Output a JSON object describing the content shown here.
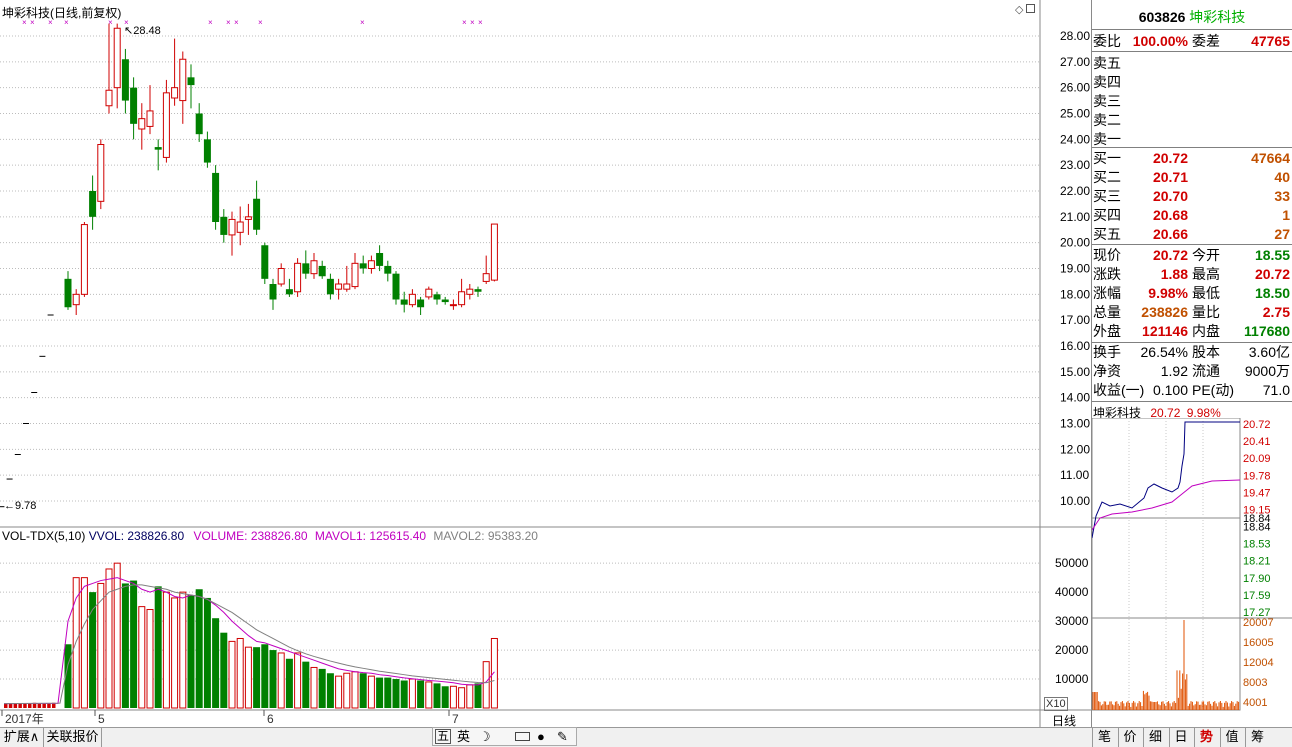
{
  "chart": {
    "title": "坤彩科技(日线,前复权)",
    "high_mark": "28.48",
    "low_mark": "9.78",
    "price_ticks": [
      "28.00",
      "27.00",
      "26.00",
      "25.00",
      "24.00",
      "23.00",
      "22.00",
      "21.00",
      "20.00",
      "19.00",
      "18.00",
      "17.00",
      "16.00",
      "15.00",
      "14.00",
      "13.00",
      "12.00",
      "11.00",
      "10.00"
    ],
    "volume_header": {
      "label": "VOL-TDX(5,10)",
      "vvol": "VVOL: 238826.80",
      "volume": "VOLUME: 238826.80",
      "mavol1": "MAVOL1: 125615.40",
      "mavol2": "MAVOL2: 95383.20"
    },
    "volume_ticks": [
      "50000",
      "40000",
      "30000",
      "20000",
      "10000"
    ],
    "volume_unit": "X10",
    "date_labels": [
      "2017年",
      "5",
      "6",
      "7"
    ],
    "period_label": "日线",
    "colors": {
      "up": "#d00000",
      "down": "#008000",
      "ma1": "#c000c0",
      "ma2": "#808080"
    }
  },
  "chart_data": {
    "type": "candlestick",
    "ylim": [
      9.5,
      28.6
    ],
    "candles": [
      {
        "o": 18.6,
        "c": 17.5,
        "h": 18.9,
        "l": 17.4
      },
      {
        "o": 17.6,
        "c": 18.0,
        "h": 18.2,
        "l": 17.2
      },
      {
        "o": 18.0,
        "c": 20.7,
        "h": 20.8,
        "l": 17.9
      },
      {
        "o": 22.0,
        "c": 21.0,
        "h": 22.6,
        "l": 20.5
      },
      {
        "o": 21.6,
        "c": 23.8,
        "h": 24.0,
        "l": 21.3
      },
      {
        "o": 25.3,
        "c": 25.9,
        "h": 28.48,
        "l": 25.0
      },
      {
        "o": 26.0,
        "c": 28.3,
        "h": 28.48,
        "l": 25.2
      },
      {
        "o": 27.1,
        "c": 25.5,
        "h": 27.5,
        "l": 25.0
      },
      {
        "o": 26.0,
        "c": 24.6,
        "h": 26.4,
        "l": 24.0
      },
      {
        "o": 24.4,
        "c": 24.8,
        "h": 25.4,
        "l": 23.6
      },
      {
        "o": 24.5,
        "c": 25.1,
        "h": 26.1,
        "l": 24.2
      },
      {
        "o": 23.7,
        "c": 23.6,
        "h": 24.0,
        "l": 22.8
      },
      {
        "o": 23.3,
        "c": 25.8,
        "h": 26.3,
        "l": 23.1
      },
      {
        "o": 25.6,
        "c": 26.0,
        "h": 27.9,
        "l": 25.3
      },
      {
        "o": 25.5,
        "c": 27.1,
        "h": 27.4,
        "l": 24.6
      },
      {
        "o": 26.4,
        "c": 26.1,
        "h": 26.9,
        "l": 25.2
      },
      {
        "o": 25.0,
        "c": 24.2,
        "h": 25.4,
        "l": 23.9
      },
      {
        "o": 24.0,
        "c": 23.1,
        "h": 24.3,
        "l": 22.9
      },
      {
        "o": 22.7,
        "c": 20.8,
        "h": 23.0,
        "l": 20.5
      },
      {
        "o": 21.0,
        "c": 20.3,
        "h": 21.3,
        "l": 20.0
      },
      {
        "o": 20.3,
        "c": 20.9,
        "h": 21.2,
        "l": 19.5
      },
      {
        "o": 20.4,
        "c": 20.8,
        "h": 21.4,
        "l": 19.9
      },
      {
        "o": 20.9,
        "c": 21.0,
        "h": 21.5,
        "l": 20.3
      },
      {
        "o": 21.7,
        "c": 20.5,
        "h": 22.4,
        "l": 20.3
      },
      {
        "o": 19.9,
        "c": 18.6,
        "h": 20.0,
        "l": 18.4
      },
      {
        "o": 18.4,
        "c": 17.8,
        "h": 18.6,
        "l": 17.4
      },
      {
        "o": 18.4,
        "c": 19.0,
        "h": 19.2,
        "l": 18.3
      },
      {
        "o": 18.2,
        "c": 18.0,
        "h": 18.6,
        "l": 17.9
      },
      {
        "o": 18.1,
        "c": 19.2,
        "h": 19.4,
        "l": 17.9
      },
      {
        "o": 19.2,
        "c": 18.8,
        "h": 19.7,
        "l": 18.6
      },
      {
        "o": 18.8,
        "c": 19.3,
        "h": 19.6,
        "l": 18.6
      },
      {
        "o": 19.1,
        "c": 18.7,
        "h": 19.3,
        "l": 18.6
      },
      {
        "o": 18.6,
        "c": 18.0,
        "h": 18.8,
        "l": 17.8
      },
      {
        "o": 18.2,
        "c": 18.4,
        "h": 18.6,
        "l": 17.8
      },
      {
        "o": 18.2,
        "c": 18.4,
        "h": 19.1,
        "l": 18.1
      },
      {
        "o": 18.3,
        "c": 19.2,
        "h": 19.6,
        "l": 18.2
      },
      {
        "o": 19.2,
        "c": 19.0,
        "h": 19.5,
        "l": 18.8
      },
      {
        "o": 19.0,
        "c": 19.3,
        "h": 19.5,
        "l": 18.8
      },
      {
        "o": 19.6,
        "c": 19.1,
        "h": 19.9,
        "l": 18.9
      },
      {
        "o": 19.1,
        "c": 18.8,
        "h": 19.3,
        "l": 18.5
      },
      {
        "o": 18.8,
        "c": 17.8,
        "h": 18.9,
        "l": 17.6
      },
      {
        "o": 17.8,
        "c": 17.6,
        "h": 18.1,
        "l": 17.3
      },
      {
        "o": 17.6,
        "c": 18.0,
        "h": 18.2,
        "l": 17.5
      },
      {
        "o": 17.8,
        "c": 17.5,
        "h": 17.9,
        "l": 17.2
      },
      {
        "o": 17.9,
        "c": 18.2,
        "h": 18.3,
        "l": 17.8
      },
      {
        "o": 18.0,
        "c": 17.8,
        "h": 18.1,
        "l": 17.6
      },
      {
        "o": 17.8,
        "c": 17.7,
        "h": 17.9,
        "l": 17.6
      },
      {
        "o": 17.6,
        "c": 17.6,
        "h": 17.8,
        "l": 17.4
      },
      {
        "o": 17.6,
        "c": 18.1,
        "h": 18.6,
        "l": 17.5
      },
      {
        "o": 18.0,
        "c": 18.2,
        "h": 18.4,
        "l": 17.8
      },
      {
        "o": 18.2,
        "c": 18.1,
        "h": 18.3,
        "l": 17.9
      },
      {
        "o": 18.5,
        "c": 18.8,
        "h": 19.5,
        "l": 18.4
      },
      {
        "o": 18.55,
        "c": 20.72,
        "h": 20.72,
        "l": 18.5
      }
    ],
    "pre_ticks": [
      {
        "i": -8,
        "v": 9.78
      },
      {
        "i": -7,
        "v": 10.85
      },
      {
        "i": -6,
        "v": 11.8
      },
      {
        "i": -5,
        "v": 13.0
      },
      {
        "i": -4,
        "v": 14.2
      },
      {
        "i": -3,
        "v": 15.6
      },
      {
        "i": -2,
        "v": 17.2
      }
    ],
    "volume_ylim": [
      0,
      58000
    ],
    "volumes": [
      22000,
      45000,
      45000,
      40000,
      43000,
      48000,
      50000,
      43000,
      44000,
      35000,
      34000,
      42000,
      40000,
      38000,
      40000,
      39000,
      41000,
      38000,
      31000,
      26000,
      23000,
      24000,
      21000,
      21000,
      22000,
      20000,
      19000,
      17000,
      19000,
      16000,
      14000,
      13500,
      12000,
      11000,
      12000,
      12500,
      12000,
      11000,
      10500,
      10500,
      10000,
      9500,
      10000,
      9500,
      9000,
      8500,
      7500,
      7500,
      7000,
      8000,
      8500,
      16000,
      24000
    ],
    "mavol1": [
      30000,
      38000,
      42000,
      43000,
      44000,
      44500,
      45000,
      44000,
      43000,
      41000,
      40000,
      41000,
      40000,
      38500,
      38000,
      39000,
      38500,
      37500,
      35500,
      33000,
      30000,
      27500,
      25000,
      23000,
      22500,
      21500,
      20500,
      19500,
      18500,
      17500,
      16500,
      15500,
      14500,
      13500,
      13000,
      12500,
      12200,
      12000,
      11500,
      11200,
      10800,
      10400,
      10100,
      9800,
      9500,
      9300,
      9000,
      8700,
      8200,
      8000,
      8000,
      9000,
      12500
    ],
    "mavol2": [
      15000,
      23000,
      29000,
      34000,
      37000,
      40000,
      41000,
      42000,
      42500,
      42500,
      42000,
      41500,
      41000,
      40000,
      39500,
      39000,
      38500,
      37500,
      36000,
      34500,
      33000,
      31000,
      29000,
      27000,
      25500,
      24000,
      22500,
      21000,
      19800,
      18700,
      17800,
      17000,
      16200,
      15500,
      14800,
      14200,
      13700,
      13200,
      12700,
      12300,
      11900,
      11500,
      11100,
      10800,
      10500,
      10200,
      9900,
      9600,
      9300,
      9000,
      8800,
      8700,
      9500
    ],
    "pre_vol": [
      1500,
      1500,
      1600,
      1500,
      1700,
      1700,
      1800,
      1600,
      1500,
      1600,
      1800
    ]
  },
  "quote": {
    "code": "603826",
    "name": "坤彩科技",
    "wb_label": "委比",
    "wb_value": "100.00%",
    "wc_label": "委差",
    "wc_value": "47765",
    "sell": [
      {
        "label": "卖五"
      },
      {
        "label": "卖四"
      },
      {
        "label": "卖三"
      },
      {
        "label": "卖二"
      },
      {
        "label": "卖一"
      }
    ],
    "buy": [
      {
        "label": "买一",
        "price": "20.72",
        "vol": "47664"
      },
      {
        "label": "买二",
        "price": "20.71",
        "vol": "40"
      },
      {
        "label": "买三",
        "price": "20.70",
        "vol": "33"
      },
      {
        "label": "买四",
        "price": "20.68",
        "vol": "1"
      },
      {
        "label": "买五",
        "price": "20.66",
        "vol": "27"
      }
    ],
    "stats": [
      {
        "l1": "现价",
        "v1": "20.72",
        "c1": "red",
        "l2": "今开",
        "v2": "18.55",
        "c2": "grn"
      },
      {
        "l1": "涨跌",
        "v1": "1.88",
        "c1": "red",
        "l2": "最高",
        "v2": "20.72",
        "c2": "red"
      },
      {
        "l1": "涨幅",
        "v1": "9.98%",
        "c1": "red",
        "l2": "最低",
        "v2": "18.50",
        "c2": "grn"
      },
      {
        "l1": "总量",
        "v1": "238826",
        "c1": "org",
        "l2": "量比",
        "v2": "2.75",
        "c2": "red"
      },
      {
        "l1": "外盘",
        "v1": "121146",
        "c1": "red",
        "l2": "内盘",
        "v2": "117680",
        "c2": "grn"
      }
    ],
    "fin": [
      {
        "l1": "换手",
        "v1": "26.54%",
        "l2": "股本",
        "v2": "3.60亿"
      },
      {
        "l1": "净资",
        "v1": "1.92",
        "l2": "流通",
        "v2": "9000万"
      },
      {
        "l1": "收益(一)",
        "v1": "0.100",
        "l2": "PE(动)",
        "v2": "71.0"
      }
    ]
  },
  "mini": {
    "title": "坤彩科技",
    "price": "20.72",
    "pct": "9.98%",
    "price_ticks": [
      "20.72",
      "20.41",
      "20.09",
      "19.78",
      "19.47",
      "19.15",
      "18.84",
      "18.53",
      "18.21",
      "17.90",
      "17.59",
      "17.27"
    ],
    "vol_ticks": [
      "20007",
      "16005",
      "12004",
      "8003",
      "4001"
    ]
  },
  "bottom": {
    "expand": "扩展∧",
    "tab": "关联报价",
    "ime": [
      "五",
      "英"
    ]
  },
  "right_tabs": [
    "笔",
    "价",
    "细",
    "日",
    "势",
    "值",
    "筹"
  ]
}
